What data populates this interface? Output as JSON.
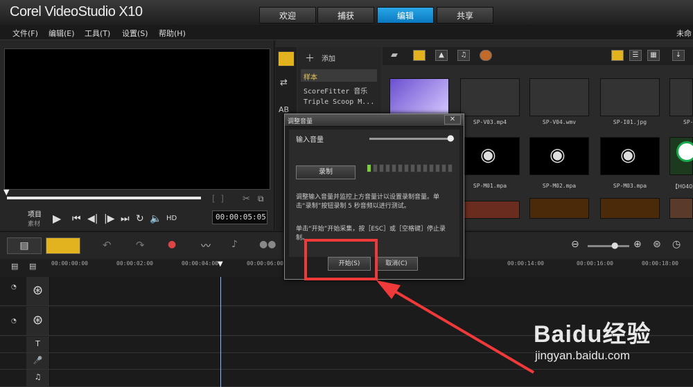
{
  "app": {
    "brand": "Corel VideoStudio X10"
  },
  "workspace_tabs": [
    {
      "label": "欢迎"
    },
    {
      "label": "捕获"
    },
    {
      "label": "编辑",
      "active": true
    },
    {
      "label": "共享"
    }
  ],
  "menu": [
    {
      "label": "文件(F)"
    },
    {
      "label": "编辑(E)"
    },
    {
      "label": "工具(T)"
    },
    {
      "label": "设置(S)"
    },
    {
      "label": "帮助(H)"
    }
  ],
  "menu_right": "未命",
  "player": {
    "mode_project": "项目",
    "mode_clip": "素材",
    "hd": "HD",
    "timecode": "00:00:05:05"
  },
  "library": {
    "add_label": "添加",
    "nav": [
      {
        "label": "样本"
      },
      {
        "label": "ScoreFitter 音乐"
      },
      {
        "label": "Triple Scoop M..."
      }
    ],
    "thumbnails": [
      {
        "label": "",
        "color": "#8c6ad6"
      },
      {
        "label": "SP-V03.mp4",
        "color": "#c9c3a9"
      },
      {
        "label": "SP-V04.wmv",
        "color": "#1a4ad8"
      },
      {
        "label": "SP-I01.jpg",
        "color": "#6f8f2f"
      },
      {
        "label": "SP-",
        "color": "#d8d0b0"
      },
      {
        "label": "SP-M01.mpa",
        "color": "#000000"
      },
      {
        "label": "SP-M02.mpa",
        "color": "#000000"
      },
      {
        "label": "SP-M03.mpa",
        "color": "#000000"
      },
      {
        "label": "【H040】",
        "color": "#1e3a1e"
      }
    ]
  },
  "timeline": {
    "ticks": [
      "00:00:00:00",
      "00:00:02:00",
      "00:00:04:00",
      "00:00:06:00",
      "00:00:14:00",
      "00:00:16:00",
      "00:00:18:00"
    ]
  },
  "dialog": {
    "title": "调整音量",
    "close": "✕",
    "input_volume_label": "输入音量",
    "record_button": "录制",
    "description": "调整输入音量并监控上方音量计以设置录制音量。单击“录制”按钮录制 5 秒音频以进行测试。",
    "instruction": "单击“开始”开始采集，按［ESC］或［空格键］停止录制。",
    "start_button": "开始(S)",
    "cancel_button": "取消(C)"
  },
  "watermark": {
    "brand": "Baidu经验",
    "url": "jingyan.baidu.com"
  },
  "colors": {
    "accent": "#1a8fd6",
    "highlight": "#f03a3a"
  }
}
